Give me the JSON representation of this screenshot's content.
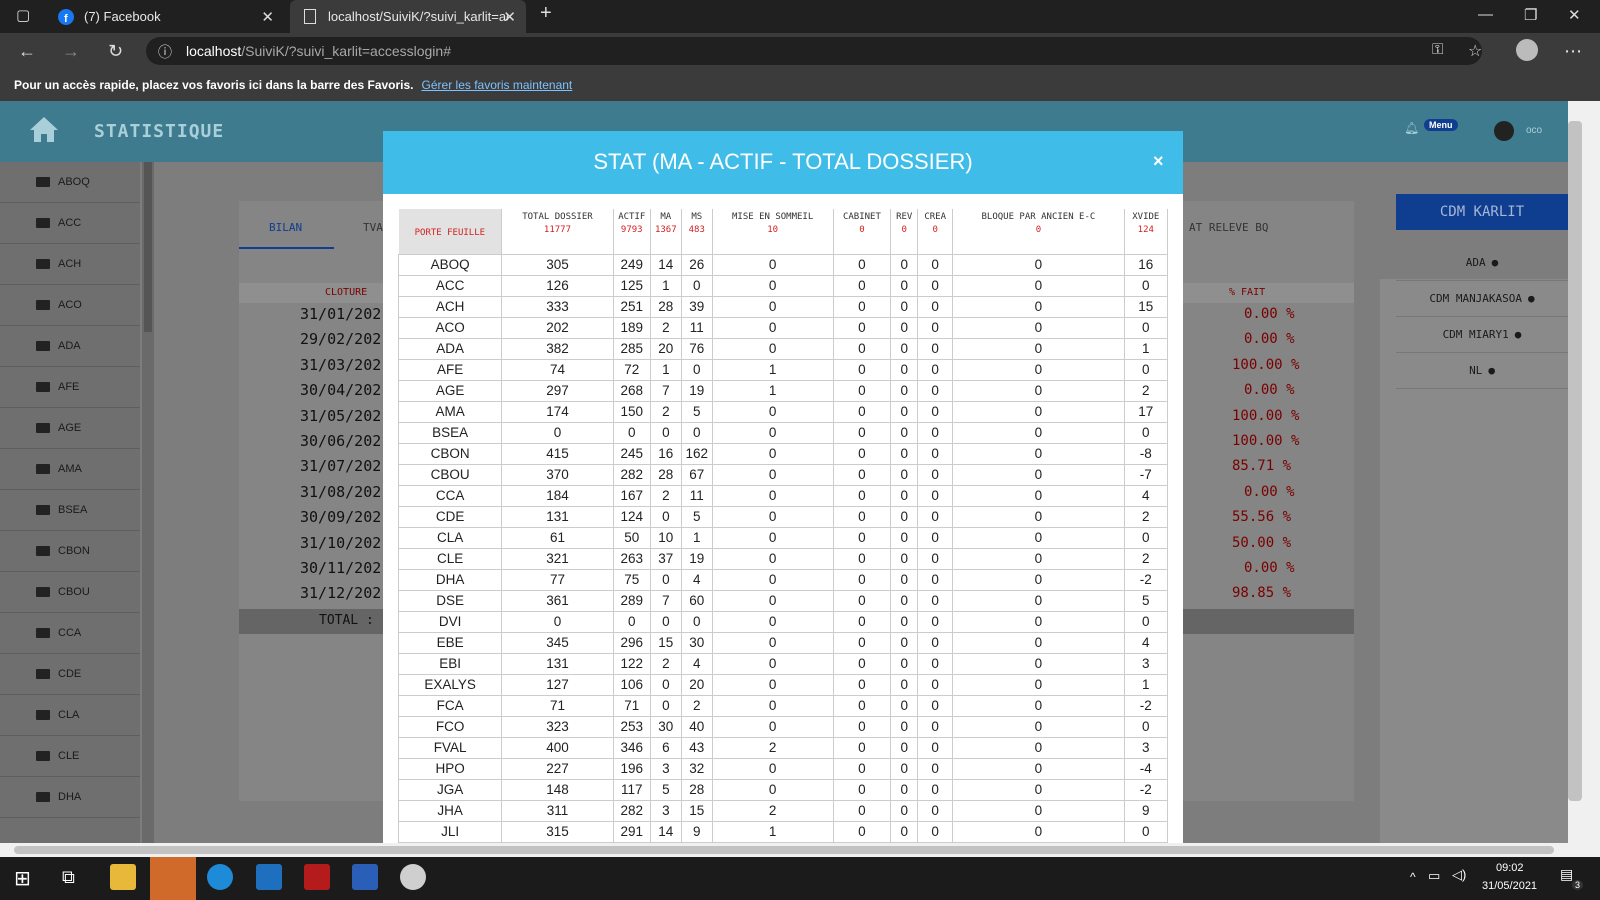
{
  "browser": {
    "tabs": [
      {
        "title": "(7) Facebook"
      },
      {
        "title": "localhost/SuiviK/?suivi_karlit=acc"
      }
    ],
    "url_host": "localhost",
    "url_path": "/SuiviK/?suivi_karlit=accesslogin#",
    "favbar_text": "Pour un accès rapide, placez vos favoris ici dans la barre des Favoris.",
    "favbar_link": "Gérer les favoris maintenant"
  },
  "app": {
    "title": "STATISTIQUE",
    "menu_badge": "Menu",
    "user": "oco",
    "sidebar": [
      "ABOQ",
      "ACC",
      "ACH",
      "ACO",
      "ADA",
      "AFE",
      "AGE",
      "AMA",
      "BSEA",
      "CBON",
      "CBOU",
      "CCA",
      "CDE",
      "CLA",
      "CLE",
      "DHA"
    ],
    "tabs": [
      "BILAN",
      "TVA",
      "AT RELEVE BQ"
    ],
    "columns": {
      "cloture": "CLOTURE",
      "pct": "% FAIT"
    },
    "dates": [
      "31/01/202",
      "29/02/202",
      "31/03/202",
      "30/04/202",
      "31/05/202",
      "30/06/202",
      "31/07/202",
      "31/08/202",
      "30/09/202",
      "31/10/202",
      "30/11/202",
      "31/12/202"
    ],
    "pcts": [
      "0.00 %",
      "0.00 %",
      "100.00 %",
      "0.00 %",
      "100.00 %",
      "100.00 %",
      "85.71 %",
      "0.00 %",
      "55.56 %",
      "50.00 %",
      "0.00 %",
      "98.85 %"
    ],
    "total_label": "TOTAL :",
    "right_title": "CDM KARLIT",
    "right_users": [
      "ADA",
      "CDM MANJAKASOA",
      "CDM MIARY1",
      "NL"
    ]
  },
  "modal": {
    "title": "STAT (MA - ACTIF - TOTAL DOSSIER)",
    "close": "×",
    "headers": [
      {
        "label": "PORTE FEUILLE",
        "value": ""
      },
      {
        "label": "TOTAL DOSSIER",
        "value": "11777"
      },
      {
        "label": "ACTIF",
        "value": "9793"
      },
      {
        "label": "MA",
        "value": "1367"
      },
      {
        "label": "MS",
        "value": "483"
      },
      {
        "label": "MISE EN SOMMEIL",
        "value": "10"
      },
      {
        "label": "CABINET",
        "value": "0"
      },
      {
        "label": "REV",
        "value": "0"
      },
      {
        "label": "CREA",
        "value": "0"
      },
      {
        "label": "BLOQUE PAR ANCIEN E-C",
        "value": "0"
      },
      {
        "label": "XVIDE",
        "value": "124"
      }
    ],
    "rows": [
      [
        "ABOQ",
        "305",
        "249",
        "14",
        "26",
        "0",
        "0",
        "0",
        "0",
        "0",
        "16"
      ],
      [
        "ACC",
        "126",
        "125",
        "1",
        "0",
        "0",
        "0",
        "0",
        "0",
        "0",
        "0"
      ],
      [
        "ACH",
        "333",
        "251",
        "28",
        "39",
        "0",
        "0",
        "0",
        "0",
        "0",
        "15"
      ],
      [
        "ACO",
        "202",
        "189",
        "2",
        "11",
        "0",
        "0",
        "0",
        "0",
        "0",
        "0"
      ],
      [
        "ADA",
        "382",
        "285",
        "20",
        "76",
        "0",
        "0",
        "0",
        "0",
        "0",
        "1"
      ],
      [
        "AFE",
        "74",
        "72",
        "1",
        "0",
        "1",
        "0",
        "0",
        "0",
        "0",
        "0"
      ],
      [
        "AGE",
        "297",
        "268",
        "7",
        "19",
        "1",
        "0",
        "0",
        "0",
        "0",
        "2"
      ],
      [
        "AMA",
        "174",
        "150",
        "2",
        "5",
        "0",
        "0",
        "0",
        "0",
        "0",
        "17"
      ],
      [
        "BSEA",
        "0",
        "0",
        "0",
        "0",
        "0",
        "0",
        "0",
        "0",
        "0",
        "0"
      ],
      [
        "CBON",
        "415",
        "245",
        "16",
        "162",
        "0",
        "0",
        "0",
        "0",
        "0",
        "-8"
      ],
      [
        "CBOU",
        "370",
        "282",
        "28",
        "67",
        "0",
        "0",
        "0",
        "0",
        "0",
        "-7"
      ],
      [
        "CCA",
        "184",
        "167",
        "2",
        "11",
        "0",
        "0",
        "0",
        "0",
        "0",
        "4"
      ],
      [
        "CDE",
        "131",
        "124",
        "0",
        "5",
        "0",
        "0",
        "0",
        "0",
        "0",
        "2"
      ],
      [
        "CLA",
        "61",
        "50",
        "10",
        "1",
        "0",
        "0",
        "0",
        "0",
        "0",
        "0"
      ],
      [
        "CLE",
        "321",
        "263",
        "37",
        "19",
        "0",
        "0",
        "0",
        "0",
        "0",
        "2"
      ],
      [
        "DHA",
        "77",
        "75",
        "0",
        "4",
        "0",
        "0",
        "0",
        "0",
        "0",
        "-2"
      ],
      [
        "DSE",
        "361",
        "289",
        "7",
        "60",
        "0",
        "0",
        "0",
        "0",
        "0",
        "5"
      ],
      [
        "DVI",
        "0",
        "0",
        "0",
        "0",
        "0",
        "0",
        "0",
        "0",
        "0",
        "0"
      ],
      [
        "EBE",
        "345",
        "296",
        "15",
        "30",
        "0",
        "0",
        "0",
        "0",
        "0",
        "4"
      ],
      [
        "EBI",
        "131",
        "122",
        "2",
        "4",
        "0",
        "0",
        "0",
        "0",
        "0",
        "3"
      ],
      [
        "EXALYS",
        "127",
        "106",
        "0",
        "20",
        "0",
        "0",
        "0",
        "0",
        "0",
        "1"
      ],
      [
        "FCA",
        "71",
        "71",
        "0",
        "2",
        "0",
        "0",
        "0",
        "0",
        "0",
        "-2"
      ],
      [
        "FCO",
        "323",
        "253",
        "30",
        "40",
        "0",
        "0",
        "0",
        "0",
        "0",
        "0"
      ],
      [
        "FVAL",
        "400",
        "346",
        "6",
        "43",
        "2",
        "0",
        "0",
        "0",
        "0",
        "3"
      ],
      [
        "HPO",
        "227",
        "196",
        "3",
        "32",
        "0",
        "0",
        "0",
        "0",
        "0",
        "-4"
      ],
      [
        "JGA",
        "148",
        "117",
        "5",
        "28",
        "0",
        "0",
        "0",
        "0",
        "0",
        "-2"
      ],
      [
        "JHA",
        "311",
        "282",
        "3",
        "15",
        "2",
        "0",
        "0",
        "0",
        "0",
        "9"
      ],
      [
        "JLI",
        "315",
        "291",
        "14",
        "9",
        "1",
        "0",
        "0",
        "0",
        "0",
        "0"
      ]
    ]
  },
  "taskbar": {
    "time": "09:02",
    "date": "31/05/2021",
    "notif_count": "3"
  },
  "colors": {
    "accent": "#3fbde8",
    "header": "#3e7b8e",
    "red": "#d21f1f"
  }
}
